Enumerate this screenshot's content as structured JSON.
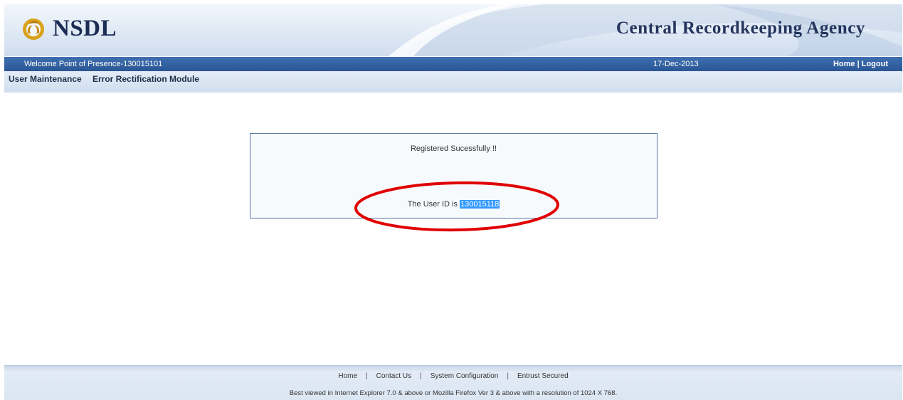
{
  "header": {
    "logo_text": "NSDL",
    "agency_title": "Central Recordkeeping Agency"
  },
  "topbar": {
    "welcome": "Welcome Point of Presence-130015101",
    "date": "17-Dec-2013",
    "home_link": "Home",
    "separator": "|",
    "logout_link": "Logout"
  },
  "menu": {
    "items": [
      {
        "label": "User Maintenance"
      },
      {
        "label": "Error Rectification Module"
      }
    ]
  },
  "message": {
    "success": "Registered Sucessfully !!",
    "userid_prefix": "The User ID is ",
    "userid_value": "130015118"
  },
  "footer": {
    "links": [
      {
        "label": "Home"
      },
      {
        "label": "Contact Us"
      },
      {
        "label": "System Configuration"
      },
      {
        "label": "Entrust Secured"
      }
    ],
    "separator": "|",
    "note": "Best viewed in Internet Explorer 7.0 & above or Mozilla Firefox Ver 3 & above with a resolution of 1024 X 768."
  },
  "colors": {
    "brand_dark": "#1b2c55",
    "topbar_blue": "#2b5694",
    "selection_blue": "#3399ff",
    "annotation_red": "#e00000"
  },
  "icons": {
    "logo": "nsdl-logo-icon"
  }
}
